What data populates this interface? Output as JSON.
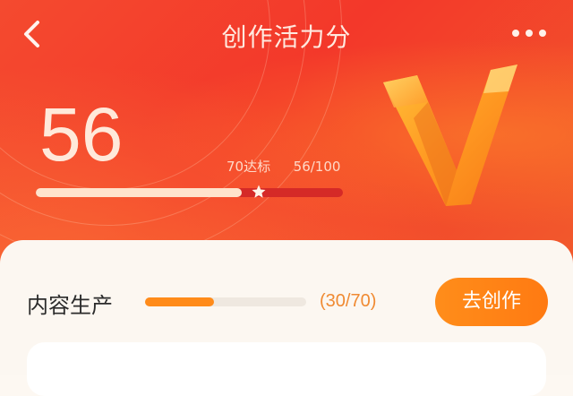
{
  "header": {
    "title": "创作活力分",
    "back_icon": "chevron-left-icon",
    "more_icon": "more-dots-icon"
  },
  "score": {
    "value": "56",
    "target_text": "70达标",
    "progress_text": "56/100",
    "progress_fraction": 0.56,
    "target_fraction": 0.7,
    "badge_icon": "v-badge-icon"
  },
  "tasks": [
    {
      "label": "内容生产",
      "progress_text": "(30/70)",
      "progress_fraction": 0.43,
      "button_label": "去创作"
    }
  ],
  "colors": {
    "hero_red": "#f3382a",
    "accent_orange": "#ff8b1a",
    "progress_orange_text": "#f08a32"
  }
}
